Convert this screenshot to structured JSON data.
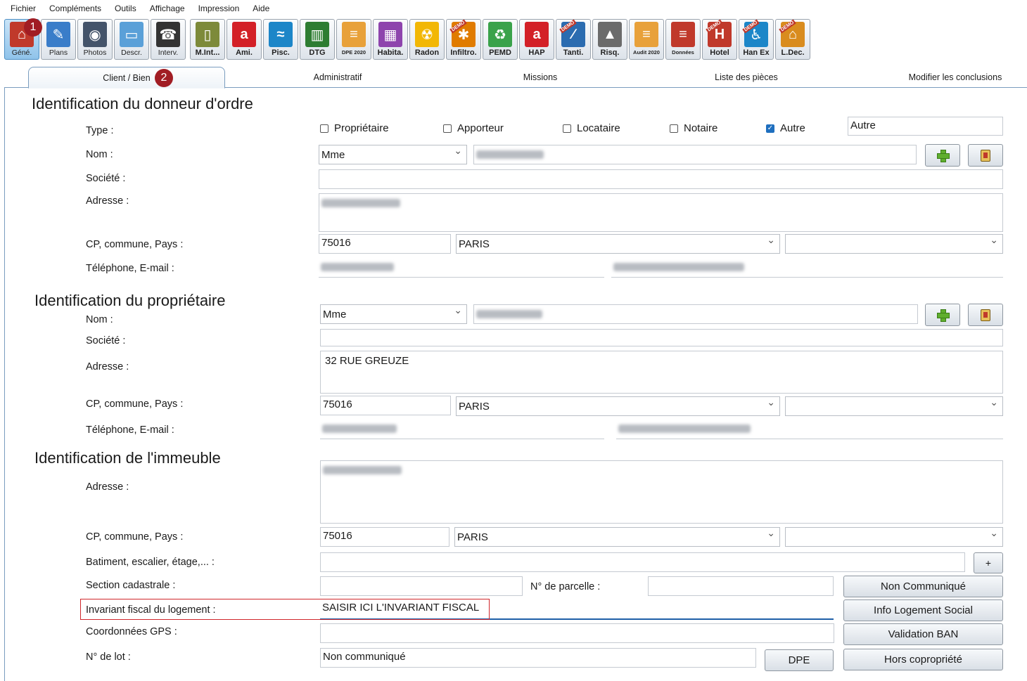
{
  "menu": [
    "Fichier",
    "Compléments",
    "Outils",
    "Affichage",
    "Impression",
    "Aide"
  ],
  "toolbar": {
    "buttons": [
      {
        "label": "Géné.",
        "icon": "house-icon",
        "color": "#c0392b"
      },
      {
        "label": "Plans",
        "icon": "plan-icon",
        "color": "#3a7dc9"
      },
      {
        "label": "Photos",
        "icon": "camera-icon",
        "color": "#44546a"
      },
      {
        "label": "Descr.",
        "icon": "description-icon",
        "color": "#5aa0d8"
      },
      {
        "label": "Interv.",
        "icon": "phone-icon",
        "color": "#333333"
      },
      {
        "label": "M.Int...",
        "icon": "door-icon",
        "color": "#7d8a3a"
      },
      {
        "label": "Ami.",
        "icon": "asbestos-icon",
        "color": "#d32027"
      },
      {
        "label": "Pisc.",
        "icon": "pool-icon",
        "color": "#1c86c8"
      },
      {
        "label": "DTG",
        "icon": "building-icon",
        "color": "#2e7d32"
      },
      {
        "label": "DPE 2020",
        "icon": "energy-label-icon",
        "color": "#e8a13a"
      },
      {
        "label": "Habita.",
        "icon": "calculator-icon",
        "color": "#8e44ad"
      },
      {
        "label": "Radon",
        "icon": "radiation-icon",
        "color": "#f2b705"
      },
      {
        "label": "Infiltro.",
        "icon": "fan-icon",
        "color": "#e07b00"
      },
      {
        "label": "PEMD",
        "icon": "recycle-icon",
        "color": "#3aa24a"
      },
      {
        "label": "HAP",
        "icon": "hap-icon",
        "color": "#d32027"
      },
      {
        "label": "Tanti.",
        "icon": "compass-icon",
        "color": "#2b6cb0"
      },
      {
        "label": "Risq.",
        "icon": "hazard-icon",
        "color": "#6b6b6b"
      },
      {
        "label": "Audit 2020",
        "icon": "audit-icon",
        "color": "#e8a13a"
      },
      {
        "label": "Données",
        "icon": "data-icon",
        "color": "#c0392b"
      },
      {
        "label": "Hotel",
        "icon": "hotel-icon",
        "color": "#c0392b"
      },
      {
        "label": "Han Ex",
        "icon": "wheelchair-icon",
        "color": "#1c86c8"
      },
      {
        "label": "L.Dec.",
        "icon": "house-demo-icon",
        "color": "#d98c1e"
      }
    ],
    "demo_text": "DEMO"
  },
  "badges": {
    "one": "1",
    "two": "2"
  },
  "tabs": [
    "Client / Bien",
    "Administratif",
    "Missions",
    "Liste des pièces",
    "Modifier les conclusions"
  ],
  "donneur": {
    "title": "Identification du donneur d'ordre",
    "type_label": "Type :",
    "checkboxes": [
      {
        "label": "Propriétaire",
        "checked": false
      },
      {
        "label": "Apporteur",
        "checked": false
      },
      {
        "label": "Locataire",
        "checked": false
      },
      {
        "label": "Notaire",
        "checked": false
      },
      {
        "label": "Autre",
        "checked": true
      }
    ],
    "autre_value": "Autre",
    "nom_label": "Nom :",
    "civilite": "Mme",
    "societe_label": "Société :",
    "adresse_label": "Adresse :",
    "cp_label": "CP, commune, Pays :",
    "cp": "75016",
    "commune": "PARIS",
    "pays": "",
    "tel_label": "Téléphone, E-mail :"
  },
  "proprietaire": {
    "title": "Identification du propriétaire",
    "nom_label": "Nom :",
    "civilite": "Mme",
    "societe_label": "Société :",
    "adresse_label": "Adresse :",
    "adresse": "32 RUE GREUZE",
    "cp_label": "CP, commune, Pays :",
    "cp": "75016",
    "commune": "PARIS",
    "pays": "",
    "tel_label": "Téléphone, E-mail :"
  },
  "immeuble": {
    "title": "Identification de l'immeuble",
    "adresse_label": "Adresse :",
    "cp_label": "CP, commune, Pays :",
    "cp": "75016",
    "commune": "PARIS",
    "pays": "",
    "batiment_label": "Batiment, escalier, étage,... :",
    "section_label": "Section cadastrale :",
    "parcelle_label": "N° de parcelle :",
    "invariant_label": "Invariant fiscal du logement :",
    "invariant_value": "SAISIR ICI L'INVARIANT FISCAL",
    "gps_label": "Coordonnées GPS :",
    "lot_label": "N° de lot :",
    "lot_value": "Non communiqué",
    "plus": "+",
    "buttons": {
      "non_communique": "Non Communiqué",
      "info_logement": "Info Logement Social",
      "validation_ban": "Validation BAN",
      "dpe": "DPE",
      "hors_copro": "Hors copropriété"
    }
  }
}
